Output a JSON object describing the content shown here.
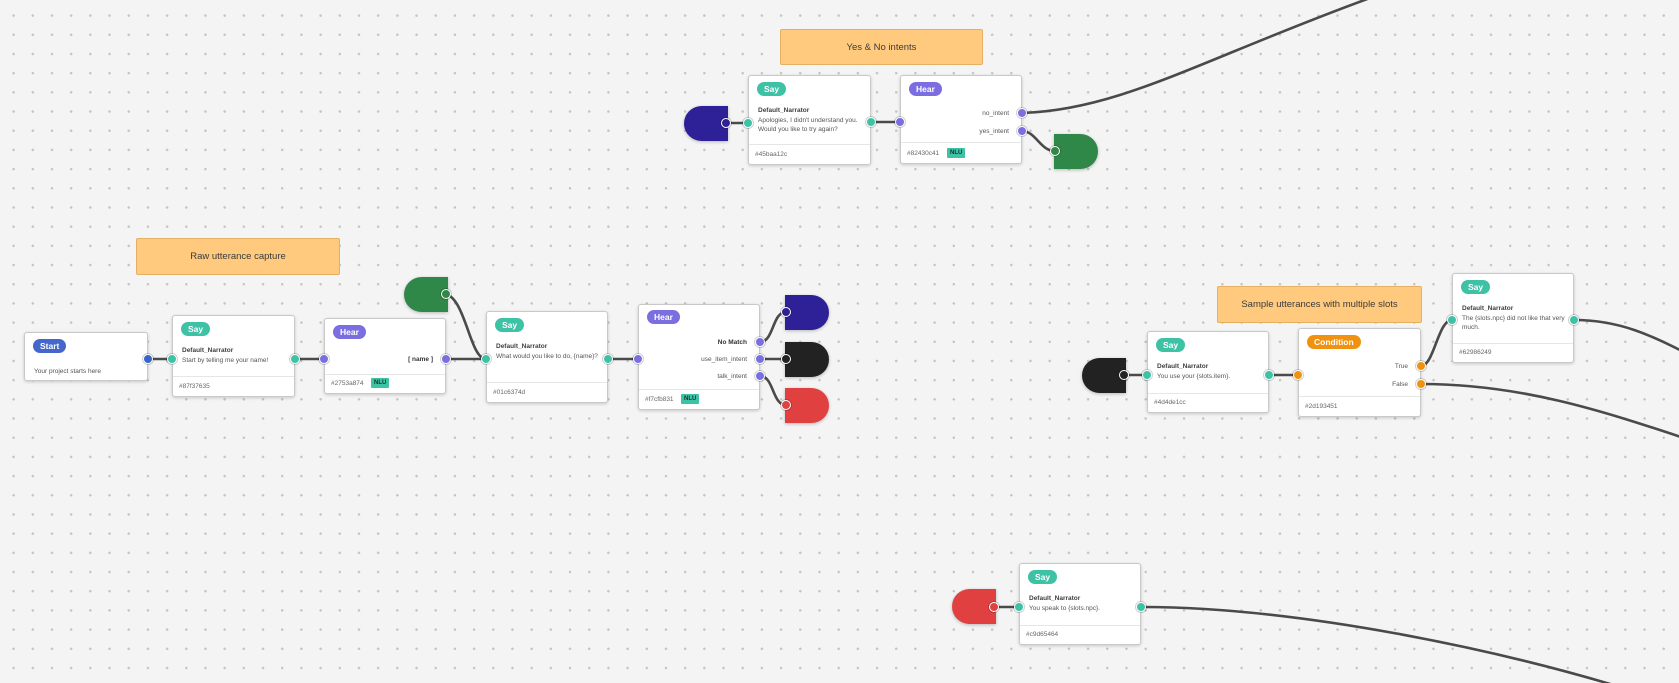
{
  "comments": {
    "yes_no": "Yes & No intents",
    "raw_capture": "Raw utterance capture",
    "multi_slots": "Sample utterances with multiple slots"
  },
  "nodes": {
    "start": {
      "badge": "Start",
      "text": "Your project starts here"
    },
    "say_name": {
      "badge": "Say",
      "speaker": "Default_Narrator",
      "text": "Start by telling me your name!",
      "id": "#87f37635"
    },
    "hear_name": {
      "badge": "Hear",
      "slot": "[ name ]",
      "id": "#2753a874",
      "nlu": "NLU"
    },
    "say_what": {
      "badge": "Say",
      "speaker": "Default_Narrator",
      "text": "What would you like to do, {name}?",
      "id": "#01c6374d"
    },
    "hear_intents": {
      "badge": "Hear",
      "ports": [
        "No Match",
        "use_item_intent",
        "talk_intent"
      ],
      "id": "#f7cfb831",
      "nlu": "NLU"
    },
    "say_apology": {
      "badge": "Say",
      "speaker": "Default_Narrator",
      "text": "Apologies, I didn't understand you. Would you like to try again?",
      "id": "#45baa12c"
    },
    "hear_yesno": {
      "badge": "Hear",
      "ports": [
        "no_intent",
        "yes_intent"
      ],
      "id": "#82430c41",
      "nlu": "NLU"
    },
    "say_use": {
      "badge": "Say",
      "speaker": "Default_Narrator",
      "text": "You use your {slots.item}.",
      "id": "#4d4de1cc"
    },
    "condition": {
      "badge": "Condition",
      "ports": [
        "True",
        "False"
      ],
      "id": "#2d193451"
    },
    "say_dislike": {
      "badge": "Say",
      "speaker": "Default_Narrator",
      "text": "The {slots.npc} did not like that very much.",
      "id": "#62986249"
    },
    "say_speak": {
      "badge": "Say",
      "speaker": "Default_Narrator",
      "text": "You speak to {slots.npc}.",
      "id": "#c9d65464"
    }
  },
  "colors": {
    "say": "#3ec2a5",
    "hear": "#7b6ee0",
    "start": "#4467cc",
    "condition": "#f0920f",
    "comment": "#ffca7e",
    "navy_port": "#2e2198",
    "green_port": "#2f8848",
    "dark_port": "#222222",
    "red_port": "#e04040",
    "wire": "#4a4a4a"
  }
}
